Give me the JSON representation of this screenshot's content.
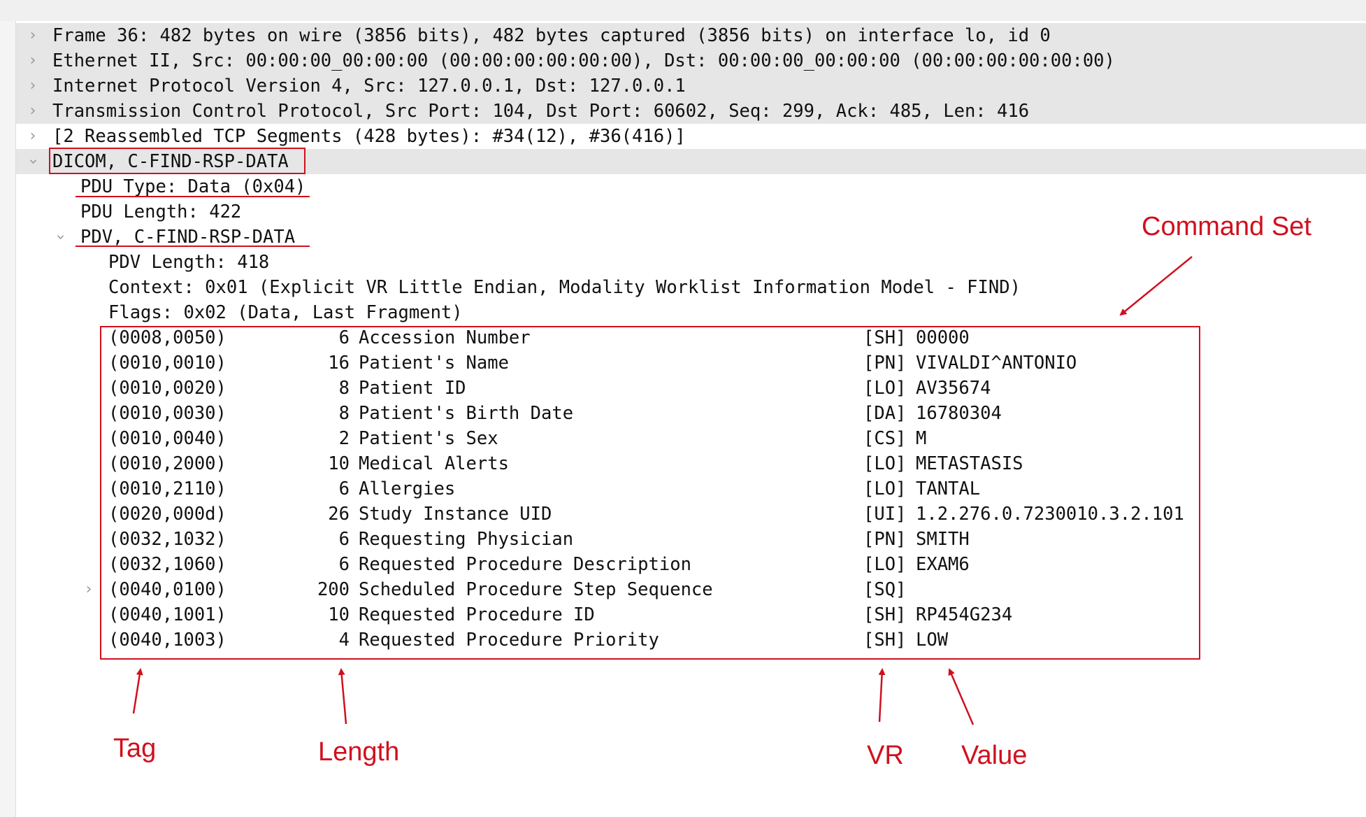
{
  "tree": {
    "frame": "Frame 36: 482 bytes on wire (3856 bits), 482 bytes captured (3856 bits) on interface lo, id 0",
    "ethernet": "Ethernet II, Src: 00:00:00_00:00:00 (00:00:00:00:00:00), Dst: 00:00:00_00:00:00 (00:00:00:00:00:00)",
    "ip": "Internet Protocol Version 4, Src: 127.0.0.1, Dst: 127.0.0.1",
    "tcp": "Transmission Control Protocol, Src Port: 104, Dst Port: 60602, Seq: 299, Ack: 485, Len: 416",
    "reassembled": "[2 Reassembled TCP Segments (428 bytes): #34(12), #36(416)]",
    "dicom": "DICOM, C-FIND-RSP-DATA",
    "pdu_type": "PDU Type: Data (0x04)",
    "pdu_length": "PDU Length: 422",
    "pdv": "PDV, C-FIND-RSP-DATA",
    "pdv_length": "PDV Length: 418",
    "context": "Context: 0x01 (Explicit VR Little Endian, Modality Worklist Information Model - FIND)",
    "flags": "Flags: 0x02 (Data, Last Fragment)"
  },
  "elements": [
    {
      "tag": "(0008,0050)",
      "length": "6",
      "name": "Accession Number",
      "vr": "[SH]",
      "value": "00000"
    },
    {
      "tag": "(0010,0010)",
      "length": "16",
      "name": "Patient's Name",
      "vr": "[PN]",
      "value": "VIVALDI^ANTONIO"
    },
    {
      "tag": "(0010,0020)",
      "length": "8",
      "name": "Patient ID",
      "vr": "[LO]",
      "value": "AV35674"
    },
    {
      "tag": "(0010,0030)",
      "length": "8",
      "name": "Patient's Birth Date",
      "vr": "[DA]",
      "value": "16780304"
    },
    {
      "tag": "(0010,0040)",
      "length": "2",
      "name": "Patient's Sex",
      "vr": "[CS]",
      "value": "M"
    },
    {
      "tag": "(0010,2000)",
      "length": "10",
      "name": "Medical Alerts",
      "vr": "[LO]",
      "value": "METASTASIS"
    },
    {
      "tag": "(0010,2110)",
      "length": "6",
      "name": "Allergies",
      "vr": "[LO]",
      "value": "TANTAL"
    },
    {
      "tag": "(0020,000d)",
      "length": "26",
      "name": "Study Instance UID",
      "vr": "[UI]",
      "value": "1.2.276.0.7230010.3.2.101"
    },
    {
      "tag": "(0032,1032)",
      "length": "6",
      "name": "Requesting Physician",
      "vr": "[PN]",
      "value": "SMITH"
    },
    {
      "tag": "(0032,1060)",
      "length": "6",
      "name": "Requested Procedure Description",
      "vr": "[LO]",
      "value": "EXAM6"
    },
    {
      "tag": "(0040,0100)",
      "length": "200",
      "name": "Scheduled Procedure Step Sequence",
      "vr": "[SQ]",
      "value": ""
    },
    {
      "tag": "(0040,1001)",
      "length": "10",
      "name": "Requested Procedure ID",
      "vr": "[SH]",
      "value": "RP454G234"
    },
    {
      "tag": "(0040,1003)",
      "length": "4",
      "name": "Requested Procedure Priority",
      "vr": "[SH]",
      "value": "LOW"
    }
  ],
  "annotations": {
    "command_set": "Command Set",
    "tag": "Tag",
    "length": "Length",
    "vr": "VR",
    "value": "Value"
  },
  "icons": {
    "collapsed": "chevron-right-icon",
    "expanded": "chevron-down-icon"
  },
  "colors": {
    "annotation_red": "#d0101e",
    "selected_row_bg": "#e6e6e6"
  }
}
